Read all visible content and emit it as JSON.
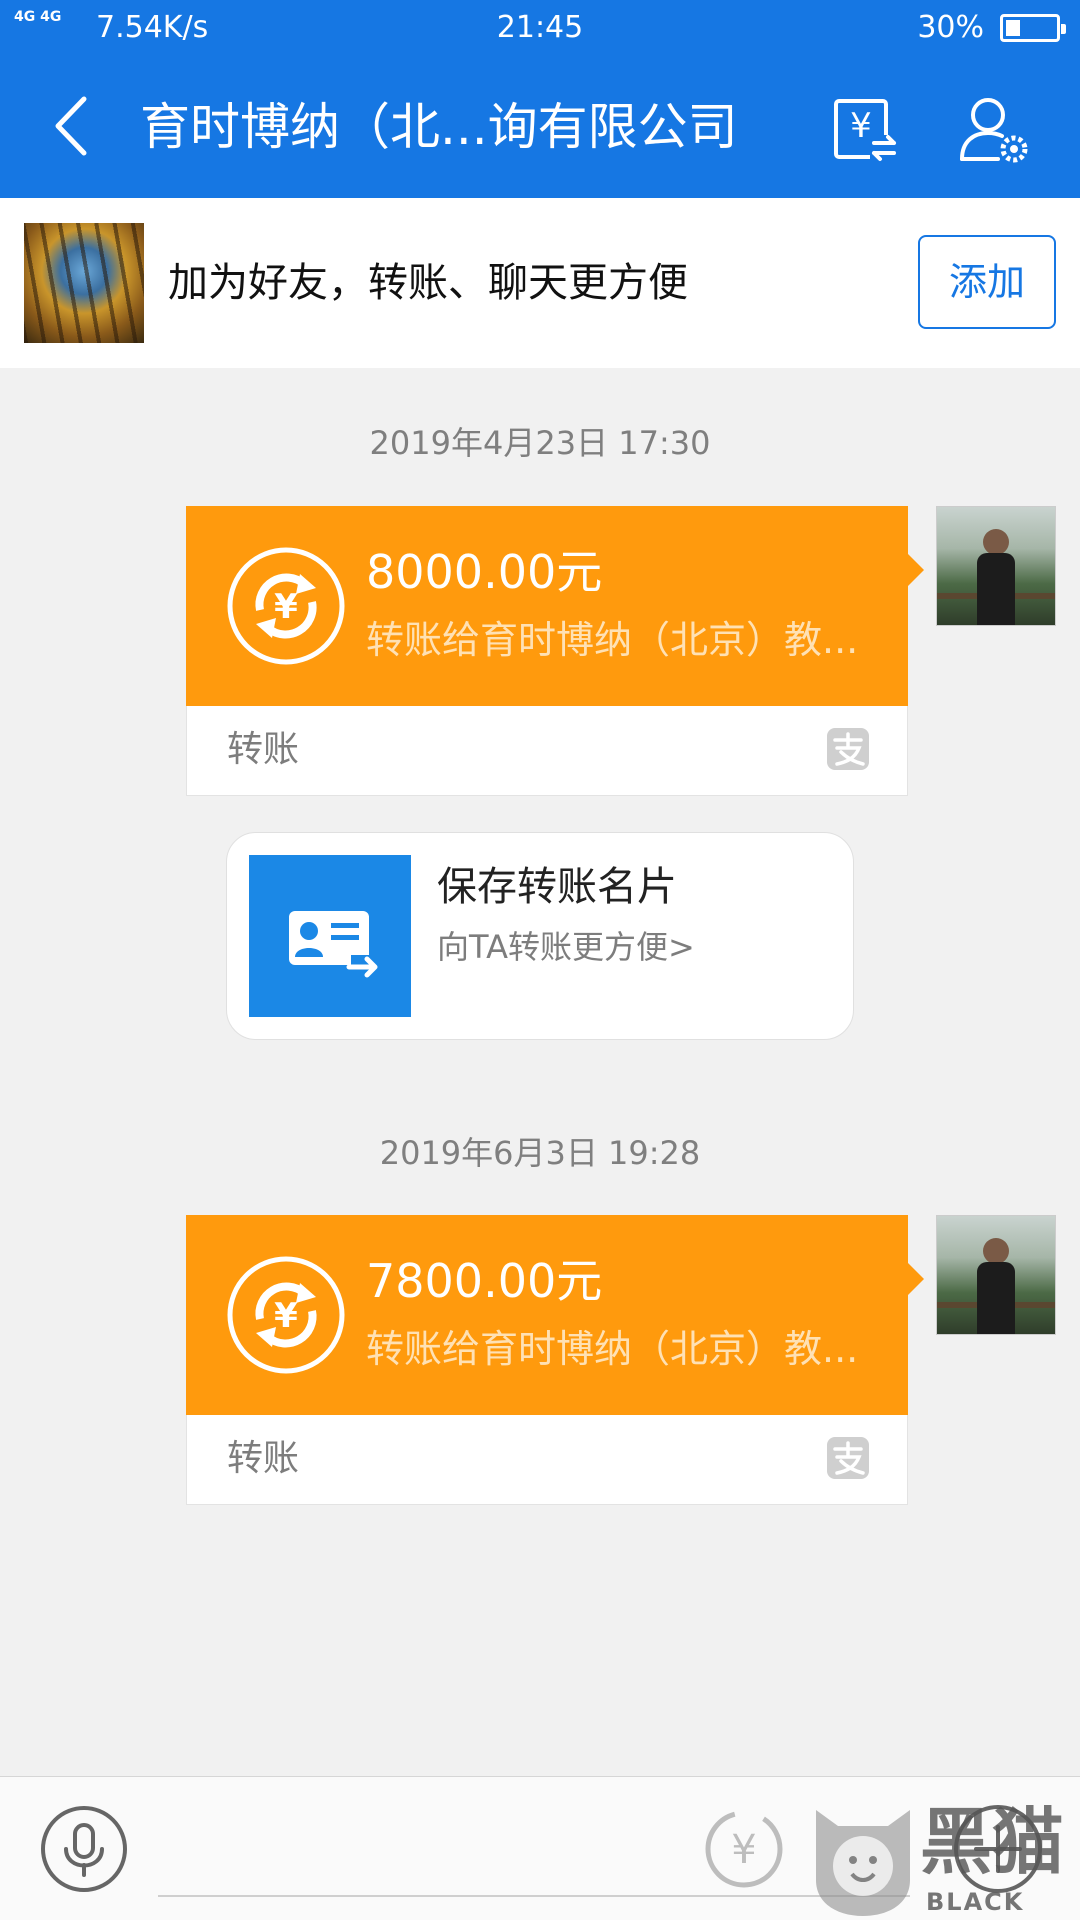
{
  "status_bar": {
    "signal_text": "4G 4G",
    "network_speed": "7.54K/s",
    "time": "21:45",
    "battery_percent": "30%",
    "battery_level": 0.3
  },
  "header": {
    "title": "育时博纳（北...询有限公司",
    "icons": [
      "back-icon",
      "transfer-record-icon",
      "contact-settings-icon"
    ]
  },
  "friend_bar": {
    "message": "加为好友，转账、聊天更方便",
    "add_label": "添加"
  },
  "messages": [
    {
      "timestamp": "2019年4月23日 17:30",
      "amount": "8000.00元",
      "description": "转账给育时博纳（北京）教...",
      "footer_label": "转账"
    },
    {
      "timestamp": "2019年6月3日 19:28",
      "amount": "7800.00元",
      "description": "转账给育时博纳（北京）教...",
      "footer_label": "转账"
    }
  ],
  "save_card": {
    "title": "保存转账名片",
    "subtitle": "向TA转账更方便>"
  },
  "watermark": {
    "brand_cn": "黑猫",
    "brand_en": "BLACK CAT"
  },
  "colors": {
    "primary": "#1677e3",
    "transfer_orange": "#ff9a0d",
    "background": "#f1f1f1"
  }
}
